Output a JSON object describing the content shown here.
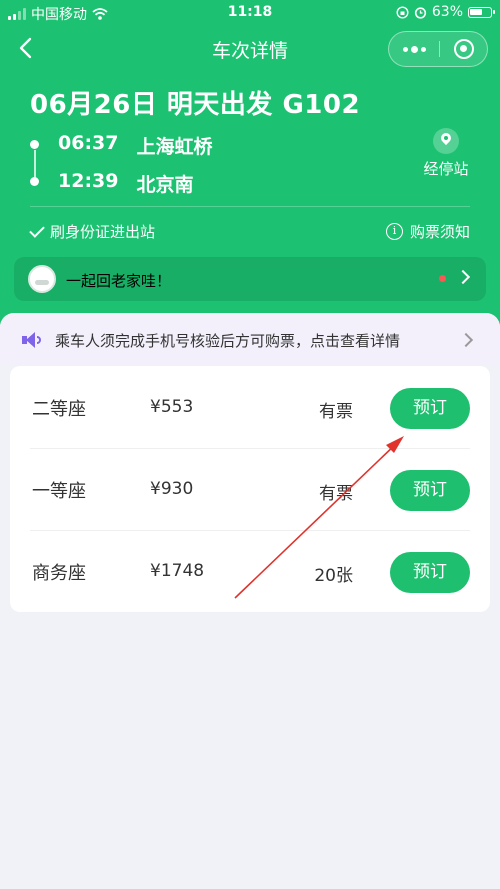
{
  "status_bar": {
    "carrier": "中国移动",
    "time": "11:18",
    "battery": "63%"
  },
  "nav": {
    "title": "车次详情"
  },
  "trip": {
    "headline": "06月26日 明天出发 G102",
    "departure": {
      "time": "06:37",
      "station": "上海虹桥"
    },
    "arrival": {
      "time": "12:39",
      "station": "北京南"
    },
    "stops_label": "经停站",
    "id_gate": "刷身份证进出站",
    "notice": "购票须知"
  },
  "promo": {
    "text": "一起回老家哇！"
  },
  "announcement": {
    "text": "乘车人须完成手机号核验后方可购票，点击查看详情"
  },
  "seats": [
    {
      "name": "二等座",
      "price": "¥553",
      "availability": "有票",
      "action": "预订"
    },
    {
      "name": "一等座",
      "price": "¥930",
      "availability": "有票",
      "action": "预订"
    },
    {
      "name": "商务座",
      "price": "¥1748",
      "availability": "20张",
      "action": "预订"
    }
  ],
  "colors": {
    "brand_green": "#1cc272",
    "button_green": "#1ebf6e",
    "accent_purple": "#7f63e8",
    "annotation_red": "#e0332d",
    "notification_dot": "#f25c54"
  }
}
